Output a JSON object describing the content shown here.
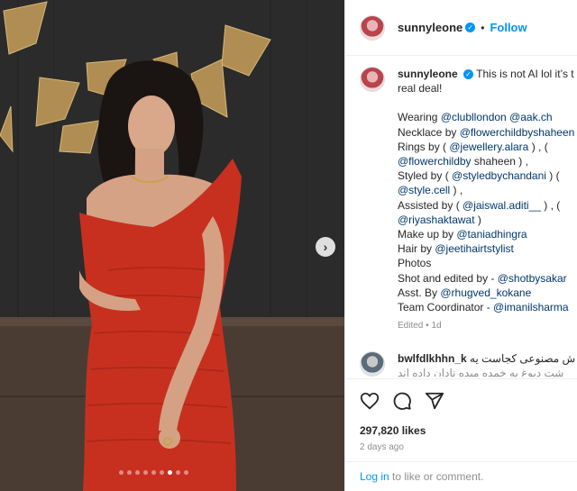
{
  "post": {
    "username": "sunnyleone",
    "follow_label": "Follow",
    "separator": "•",
    "verified_mark": "✓",
    "next_arrow": "›",
    "carousel": {
      "dot_count": 9,
      "active_dot": 6
    }
  },
  "caption": {
    "username": "sunnyleone",
    "lines": [
      [
        {
          "t": "This is not AI lol it’s t"
        }
      ],
      [
        {
          "t": "real deal!"
        }
      ],
      [],
      [
        {
          "t": "Wearing "
        },
        {
          "t": "@clubllondon",
          "m": true
        },
        {
          "t": " "
        },
        {
          "t": "@aak.ch",
          "m": true
        }
      ],
      [
        {
          "t": "Necklace by "
        },
        {
          "t": "@flowerchildbyshaheen",
          "m": true
        }
      ],
      [
        {
          "t": "Rings by ( "
        },
        {
          "t": "@jewellery.alara",
          "m": true
        },
        {
          "t": " ) , ("
        }
      ],
      [
        {
          "t": "@flowerchildby",
          "m": true
        },
        {
          "t": " shaheen ) ,"
        }
      ],
      [
        {
          "t": "Styled by ( "
        },
        {
          "t": "@styledbychandani",
          "m": true
        },
        {
          "t": " ) ("
        }
      ],
      [
        {
          "t": "@style.cell",
          "m": true
        },
        {
          "t": " ) ,"
        }
      ],
      [
        {
          "t": "Assisted by ( "
        },
        {
          "t": "@jaiswal.aditi__",
          "m": true
        },
        {
          "t": " ) , ("
        }
      ],
      [
        {
          "t": "@riyashaktawat",
          "m": true
        },
        {
          "t": " )"
        }
      ],
      [
        {
          "t": "Make up by "
        },
        {
          "t": "@taniadhingra",
          "m": true
        }
      ],
      [
        {
          "t": "Hair by "
        },
        {
          "t": "@jeetihairtstylist",
          "m": true
        }
      ],
      [
        {
          "t": "Photos"
        }
      ],
      [
        {
          "t": "Shot and edited by - "
        },
        {
          "t": "@shotbysakar",
          "m": true
        }
      ],
      [
        {
          "t": "Asst. By "
        },
        {
          "t": "@rhugved_kokane",
          "m": true
        }
      ],
      [
        {
          "t": "Team Coordinator - "
        },
        {
          "t": "@imanilsharma",
          "m": true
        }
      ]
    ],
    "edited": "Edited",
    "age": "1d"
  },
  "comment": {
    "username": "bwlfdlkhhn_k",
    "text": "ش مصنوعی کجاست یه",
    "line2": "شت دیوغ به خمده میده نادان داده اند"
  },
  "actions": {
    "icons": [
      "heart-icon",
      "comment-icon",
      "share-icon"
    ],
    "likes": "297,820 likes",
    "time": "2 days ago"
  },
  "footer": {
    "login": "Log in",
    "rest": " to like or comment."
  }
}
